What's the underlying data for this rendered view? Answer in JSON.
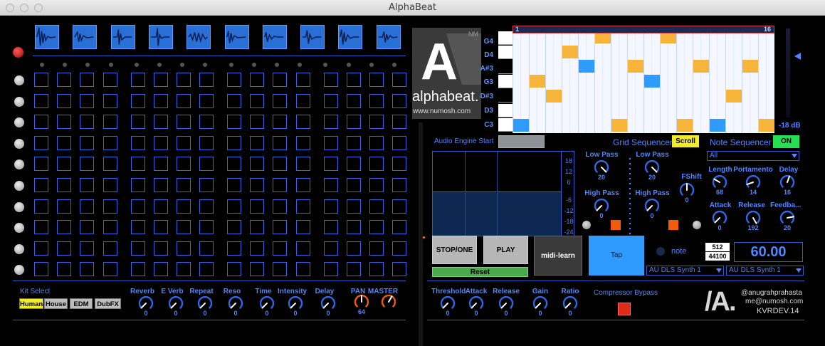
{
  "window": {
    "title": "AlphaBeat"
  },
  "logo": {
    "letter": "A",
    "badge": "NM",
    "name": "alphabeat.",
    "url": "www.numosh.com"
  },
  "piano_roll": {
    "keys": [
      "G4",
      "D4",
      "A#3",
      "G3",
      "D#3",
      "D3",
      "C3"
    ],
    "loop_start": "1",
    "loop_end": "16",
    "level": "-18 dB"
  },
  "sequencer": {
    "audio_engine_label": "Audio Engine Start",
    "grid_sequencer_label": "Grid Sequencer",
    "scroll_label": "Scroll",
    "note_sequencer_label": "Note Sequencer",
    "note_seq_state": "ON",
    "filter_option": "All"
  },
  "scope": {
    "ticks": [
      "18",
      "12",
      "6",
      "-6",
      "-12",
      "-18",
      "-24"
    ]
  },
  "filters": [
    {
      "label": "Low Pass",
      "value": "20"
    },
    {
      "label": "High Pass",
      "value": "0"
    },
    {
      "label": "Low Pass",
      "value": "20"
    },
    {
      "label": "High Pass",
      "value": "0"
    },
    {
      "label": "FShift",
      "value": "0"
    }
  ],
  "synth": [
    {
      "label": "Length",
      "value": "68"
    },
    {
      "label": "Portamento",
      "value": "14"
    },
    {
      "label": "Delay",
      "value": "16"
    },
    {
      "label": "Attack",
      "value": "0"
    },
    {
      "label": "Release",
      "value": "192"
    },
    {
      "label": "Feedba...",
      "value": "20"
    }
  ],
  "transport": {
    "stop_label": "STOP/ONE",
    "play_label": "PLAY",
    "reset_label": "Reset",
    "midi_learn_label": "midi-learn",
    "tap_label": "Tap",
    "note_label": "note",
    "buffer": "512",
    "sample_rate": "44100",
    "tempo": "60.00",
    "synth_out_1": "AU DLS Synth 1",
    "synth_out_2": "AU DLS Synth 1"
  },
  "kit": {
    "label": "Kit Select",
    "options": [
      "Human",
      "House",
      "EDM",
      "DubFX"
    ],
    "selected": "Human"
  },
  "fx": [
    {
      "label": "Reverb",
      "value": "0"
    },
    {
      "label": "E Verb",
      "value": "0"
    },
    {
      "label": "Repeat",
      "value": "0"
    },
    {
      "label": "Reso",
      "value": "0"
    },
    {
      "label": "Time",
      "value": "0"
    },
    {
      "label": "Intensity",
      "value": "0"
    },
    {
      "label": "Delay",
      "value": "0"
    },
    {
      "label": "PAN",
      "value": "64"
    },
    {
      "label": "MASTER",
      "value": ""
    }
  ],
  "compressor": [
    {
      "label": "Threshold",
      "value": "0"
    },
    {
      "label": "Attack",
      "value": "0"
    },
    {
      "label": "Release",
      "value": "0"
    },
    {
      "label": "Gain",
      "value": "0"
    },
    {
      "label": "Ratio",
      "value": "0"
    }
  ],
  "compressor_bypass_label": "Compressor Bypass",
  "credits": {
    "mark": "/A.",
    "handle": "@anugrahprahasta",
    "email": "me@numosh.com",
    "event": "KVRDEV.14"
  },
  "colors": {
    "accent": "#4f85ff",
    "pad_border": "#2f67e6",
    "note_orange": "#f7b43a",
    "note_blue": "#2f9bff",
    "on_green": "#27e051",
    "scroll_yellow": "#f0ec2c",
    "bypass_red": "#e02a1a",
    "record_red": "#cc1212"
  }
}
